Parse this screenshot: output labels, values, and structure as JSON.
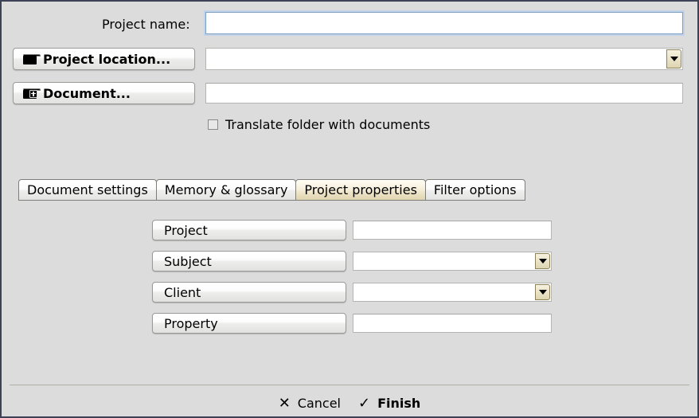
{
  "window": {
    "bg_color": "#dcdcdc",
    "border_color": "#3e4256",
    "accent_color": "#e0d5b0"
  },
  "top_form": {
    "project_name_label": "Project name:",
    "project_name_value": "",
    "project_name_placeholder": "",
    "project_location_button": "Project location...",
    "project_location_icon": "folder-icon",
    "project_location_value": "",
    "project_location_placeholder": "",
    "document_button": "Document...",
    "document_icon": "folder-add-icon",
    "document_value": "",
    "document_placeholder": "",
    "translate_checkbox_label": "Translate folder with documents",
    "translate_checkbox_checked": false
  },
  "tabs": [
    {
      "label": "Document settings",
      "active": false
    },
    {
      "label": "Memory & glossary",
      "active": false
    },
    {
      "label": "Project properties",
      "active": true
    },
    {
      "label": "Filter options",
      "active": false
    }
  ],
  "properties": [
    {
      "label": "Project",
      "value": "",
      "placeholder": "",
      "type": "text"
    },
    {
      "label": "Subject",
      "value": "",
      "placeholder": "",
      "type": "combo"
    },
    {
      "label": "Client",
      "value": "",
      "placeholder": "",
      "type": "combo"
    },
    {
      "label": "Property",
      "value": "",
      "placeholder": "",
      "type": "text"
    }
  ],
  "footer": {
    "cancel_label": "Cancel",
    "cancel_glyph": "✕",
    "finish_label": "Finish",
    "finish_glyph": "✓"
  }
}
